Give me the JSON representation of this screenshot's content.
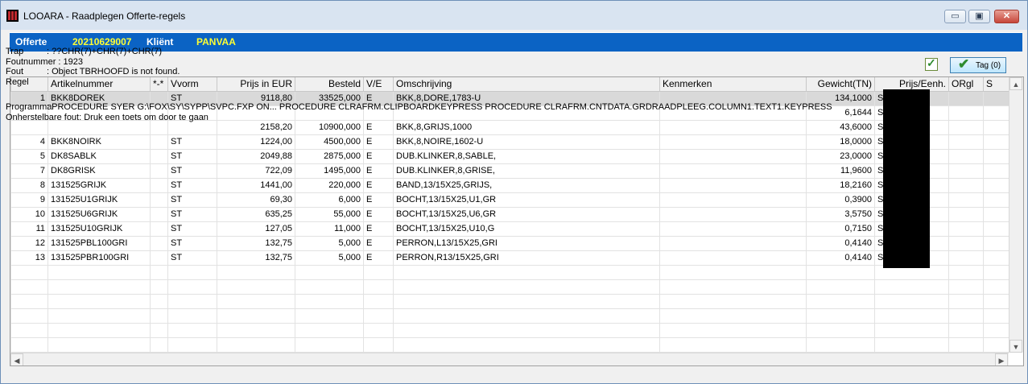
{
  "window": {
    "title": "LOOARA - Raadplegen Offerte-regels",
    "minimize_glyph": "▭",
    "maximize_glyph": "▣",
    "close_glyph": "✕"
  },
  "header": {
    "offerte_label": "Offerte",
    "offerte_value": "20210629007",
    "klient_label": "Kliënt",
    "klient_value": "PANVAA",
    "label_color": "#ffffff",
    "value_color": "#ffff33",
    "strip_color": "#0b63c4"
  },
  "toolbar": {
    "tag_label": "Tag (0)"
  },
  "grid": {
    "columns": [
      "",
      "Artikelnummer",
      "*-*",
      "Vvorm",
      "Prijs in EUR",
      "Besteld",
      "V/E",
      "Omschrijving",
      "Kenmerken",
      "Gewicht(TN)",
      "Prijs/Eenh.",
      "ORgl",
      "S"
    ],
    "rows": [
      {
        "nr": "1",
        "artikel": "BKK8DOREK",
        "star": "",
        "vorm": "ST",
        "prijs": "9118,80",
        "besteld": "33525,000",
        "ve": "E",
        "omschrijving": "BKK,8,DORE,1783-U",
        "kenmerken": "",
        "gewicht": "134,1000",
        "eenh": "SD",
        "orgl": "",
        "s": ""
      },
      {
        "nr": "",
        "artikel": "",
        "star": "",
        "vorm": "",
        "prijs": "",
        "besteld": "",
        "ve": "",
        "omschrijving": "",
        "kenmerken": "",
        "gewicht": "6,1644",
        "eenh": "SD",
        "orgl": "",
        "s": ""
      },
      {
        "nr": "",
        "artikel": "",
        "star": "",
        "vorm": "",
        "prijs": "2158,20",
        "besteld": "10900,000",
        "ve": "E",
        "omschrijving": "BKK,8,GRIJS,1000",
        "kenmerken": "",
        "gewicht": "43,6000",
        "eenh": "SD",
        "orgl": "",
        "s": ""
      },
      {
        "nr": "4",
        "artikel": "BKK8NOIRK",
        "star": "",
        "vorm": "ST",
        "prijs": "1224,00",
        "besteld": "4500,000",
        "ve": "E",
        "omschrijving": "BKK,8,NOIRE,1602-U",
        "kenmerken": "",
        "gewicht": "18,0000",
        "eenh": "SD",
        "orgl": "",
        "s": ""
      },
      {
        "nr": "5",
        "artikel": "DK8SABLK",
        "star": "",
        "vorm": "ST",
        "prijs": "2049,88",
        "besteld": "2875,000",
        "ve": "E",
        "omschrijving": "DUB.KLINKER,8,SABLE,",
        "kenmerken": "",
        "gewicht": "23,0000",
        "eenh": "SD",
        "orgl": "",
        "s": ""
      },
      {
        "nr": "7",
        "artikel": "DK8GRISK",
        "star": "",
        "vorm": "ST",
        "prijs": "722,09",
        "besteld": "1495,000",
        "ve": "E",
        "omschrijving": "DUB.KLINKER,8,GRISE,",
        "kenmerken": "",
        "gewicht": "11,9600",
        "eenh": "SD",
        "orgl": "",
        "s": ""
      },
      {
        "nr": "8",
        "artikel": "131525GRIJK",
        "star": "",
        "vorm": "ST",
        "prijs": "1441,00",
        "besteld": "220,000",
        "ve": "E",
        "omschrijving": "BAND,13/15X25,GRIJS,",
        "kenmerken": "",
        "gewicht": "18,2160",
        "eenh": "ST",
        "orgl": "",
        "s": ""
      },
      {
        "nr": "9",
        "artikel": "131525U1GRIJK",
        "star": "",
        "vorm": "ST",
        "prijs": "69,30",
        "besteld": "6,000",
        "ve": "E",
        "omschrijving": "BOCHT,13/15X25,U1,GR",
        "kenmerken": "",
        "gewicht": "0,3900",
        "eenh": "ST",
        "orgl": "",
        "s": ""
      },
      {
        "nr": "10",
        "artikel": "131525U6GRIJK",
        "star": "",
        "vorm": "ST",
        "prijs": "635,25",
        "besteld": "55,000",
        "ve": "E",
        "omschrijving": "BOCHT,13/15X25,U6,GR",
        "kenmerken": "",
        "gewicht": "3,5750",
        "eenh": "ST",
        "orgl": "",
        "s": ""
      },
      {
        "nr": "11",
        "artikel": "131525U10GRIJK",
        "star": "",
        "vorm": "ST",
        "prijs": "127,05",
        "besteld": "11,000",
        "ve": "E",
        "omschrijving": "BOCHT,13/15X25,U10,G",
        "kenmerken": "",
        "gewicht": "0,7150",
        "eenh": "ST",
        "orgl": "",
        "s": ""
      },
      {
        "nr": "12",
        "artikel": "131525PBL100GRI",
        "star": "",
        "vorm": "ST",
        "prijs": "132,75",
        "besteld": "5,000",
        "ve": "E",
        "omschrijving": "PERRON,L13/15X25,GRI",
        "kenmerken": "",
        "gewicht": "0,4140",
        "eenh": "ST",
        "orgl": "",
        "s": ""
      },
      {
        "nr": "13",
        "artikel": "131525PBR100GRI",
        "star": "",
        "vorm": "ST",
        "prijs": "132,75",
        "besteld": "5,000",
        "ve": "E",
        "omschrijving": "PERRON,R13/15X25,GRI",
        "kenmerken": "",
        "gewicht": "0,4140",
        "eenh": "ST",
        "orgl": "",
        "s": ""
      }
    ],
    "scroll_up": "▲",
    "scroll_down": "▼",
    "scroll_left": "◀",
    "scroll_right": "▶"
  },
  "error_overlay": {
    "trap_label": "Trap",
    "trap_value": ": ??CHR(7)+CHR(7)+CHR(7)",
    "foutnummer": "Foutnummer  : 1923",
    "fout_label": "Fout",
    "fout_value": ": Object TBRHOOFD is not found.",
    "regel_label": "Regel",
    "programma_label": "Programma",
    "programma_value": ": PROCEDURE SYER G:\\FOX\\SY\\SYPP\\SVPC.FXP ON...  PROCEDURE CLRAFRM.CLIPBOARDKEYPRESS  PROCEDURE CLRAFRM.CNTDATA.GRDRAADPLEEG.COLUMN1.TEXT1.KEYPRESS",
    "onherstelbare": "Onherstelbare fout:  Druk een toets om door te gaan"
  }
}
